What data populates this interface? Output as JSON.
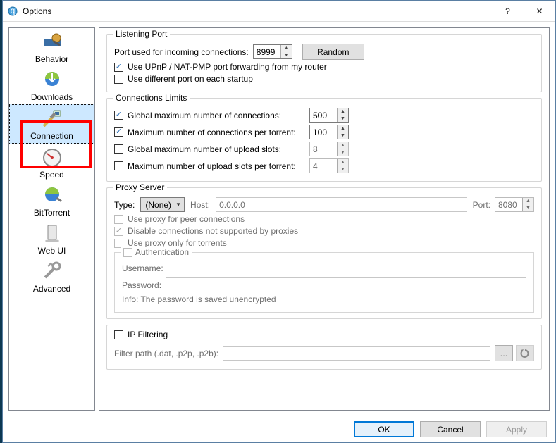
{
  "window": {
    "title": "Options",
    "help": "?",
    "close": "✕"
  },
  "sidebar": {
    "items": [
      {
        "label": "Behavior"
      },
      {
        "label": "Downloads"
      },
      {
        "label": "Connection"
      },
      {
        "label": "Speed"
      },
      {
        "label": "BitTorrent"
      },
      {
        "label": "Web UI"
      },
      {
        "label": "Advanced"
      }
    ]
  },
  "listening": {
    "title": "Listening Port",
    "port_label": "Port used for incoming connections:",
    "port_value": "8999",
    "random": "Random",
    "upnp": "Use UPnP / NAT-PMP port forwarding from my router",
    "diffport": "Use different port on each startup"
  },
  "limits": {
    "title": "Connections Limits",
    "global_conn": "Global maximum number of connections:",
    "global_conn_val": "500",
    "per_torrent": "Maximum number of connections per torrent:",
    "per_torrent_val": "100",
    "upload_slots": "Global maximum number of upload slots:",
    "upload_slots_val": "8",
    "upload_per_torrent": "Maximum number of upload slots per torrent:",
    "upload_per_torrent_val": "4"
  },
  "proxy": {
    "title": "Proxy Server",
    "type_label": "Type:",
    "type_value": "(None)",
    "host_label": "Host:",
    "host_value": "0.0.0.0",
    "port_label": "Port:",
    "port_value": "8080",
    "peer": "Use proxy for peer connections",
    "disable": "Disable connections not supported by proxies",
    "only_torrents": "Use proxy only for torrents",
    "auth": "Authentication",
    "user_label": "Username:",
    "pass_label": "Password:",
    "info": "Info: The password is saved unencrypted"
  },
  "ipf": {
    "title": "IP Filtering",
    "path_label": "Filter path (.dat, .p2p, .p2b):",
    "browse": "...",
    "reload": "↻"
  },
  "footer": {
    "ok": "OK",
    "cancel": "Cancel",
    "apply": "Apply"
  }
}
